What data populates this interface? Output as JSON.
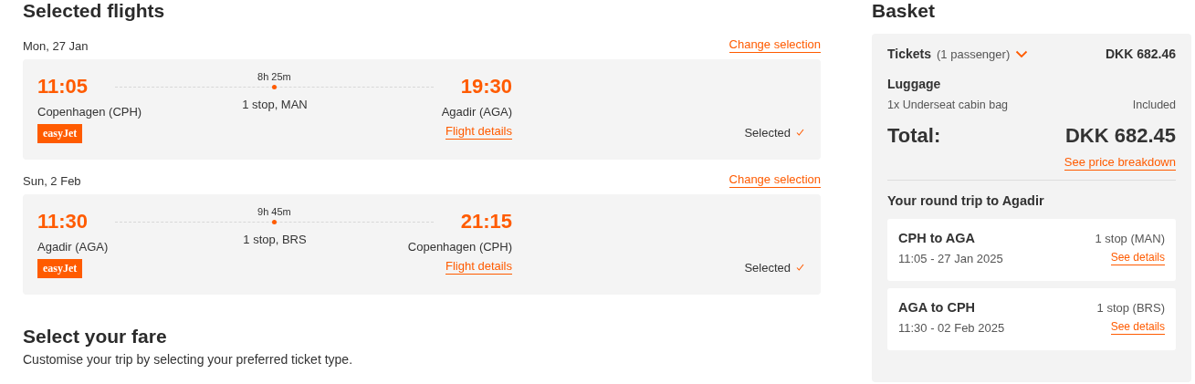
{
  "selected_flights": {
    "title": "Selected flights",
    "flights": [
      {
        "date": "Mon, 27 Jan",
        "change_link": "Change selection",
        "depart_time": "11:05",
        "depart_city": "Copenhagen (CPH)",
        "duration": "8h 25m",
        "stops": "1 stop, MAN",
        "arrive_time": "19:30",
        "arrive_city": "Agadir (AGA)",
        "airline": "easyJet",
        "details_link": "Flight details",
        "status": "Selected",
        "selected": true
      },
      {
        "date": "Sun, 2 Feb",
        "change_link": "Change selection",
        "depart_time": "11:30",
        "depart_city": "Agadir (AGA)",
        "duration": "9h 45m",
        "stops": "1 stop, BRS",
        "arrive_time": "21:15",
        "arrive_city": "Copenhagen (CPH)",
        "airline": "easyJet",
        "details_link": "Flight details",
        "status": "Selected",
        "selected": true
      }
    ]
  },
  "fare": {
    "title": "Select your fare",
    "subtitle": "Customise your trip by selecting your preferred ticket type."
  },
  "basket": {
    "title": "Basket",
    "tickets": {
      "label": "Tickets",
      "note": "(1 passenger)",
      "price": "DKK 682.46"
    },
    "luggage": {
      "title": "Luggage",
      "item": "1x Underseat cabin bag",
      "status": "Included"
    },
    "total": {
      "label": "Total:",
      "price": "DKK 682.45",
      "link": "See price breakdown"
    },
    "trip": {
      "title": "Your round trip to Agadir",
      "legs": [
        {
          "route": "CPH to AGA",
          "stops": "1 stop (MAN)",
          "when": "11:05 - 27 Jan 2025",
          "link": "See details"
        },
        {
          "route": "AGA to CPH",
          "stops": "1 stop (BRS)",
          "when": "11:30 - 02 Feb 2025",
          "link": "See details"
        }
      ]
    }
  }
}
